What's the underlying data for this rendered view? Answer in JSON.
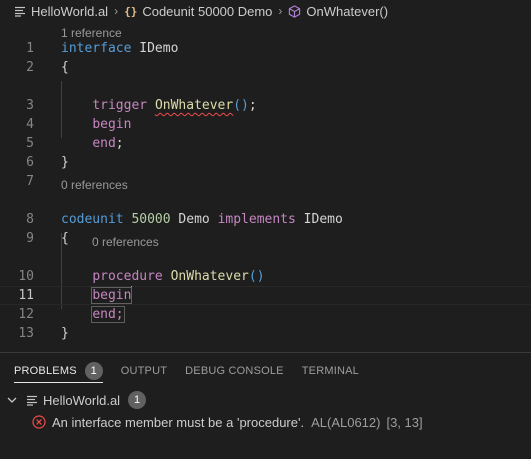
{
  "breadcrumb": {
    "file": "HelloWorld.al",
    "object": "Codeunit 50000 Demo",
    "member": "OnWhatever()"
  },
  "editor": {
    "lenses": {
      "interface_refs": "1 reference",
      "codeunit_refs": "0 references",
      "procedure_refs": "0 references"
    },
    "lines": [
      {
        "num": "1",
        "tokens": [
          {
            "t": "interface",
            "c": "kw"
          },
          {
            "t": " ",
            "c": "plain"
          },
          {
            "t": "IDemo",
            "c": "plain"
          }
        ]
      },
      {
        "num": "2",
        "tokens": [
          {
            "t": "{",
            "c": "plain"
          }
        ]
      },
      {
        "num": "3",
        "tokens": [
          {
            "t": "    ",
            "c": "plain"
          },
          {
            "t": "trigger",
            "c": "ctrl"
          },
          {
            "t": " ",
            "c": "plain"
          },
          {
            "t": "OnWhatever",
            "c": "fn squig"
          },
          {
            "t": "()",
            "c": "kw"
          },
          {
            "t": ";",
            "c": "plain"
          }
        ]
      },
      {
        "num": "4",
        "tokens": [
          {
            "t": "    ",
            "c": "plain"
          },
          {
            "t": "begin",
            "c": "ctrl"
          }
        ]
      },
      {
        "num": "5",
        "tokens": [
          {
            "t": "    ",
            "c": "plain"
          },
          {
            "t": "end",
            "c": "ctrl"
          },
          {
            "t": ";",
            "c": "plain"
          }
        ]
      },
      {
        "num": "6",
        "tokens": [
          {
            "t": "}",
            "c": "plain"
          }
        ]
      },
      {
        "num": "7",
        "tokens": []
      },
      {
        "num": "8",
        "tokens": [
          {
            "t": "codeunit",
            "c": "kw"
          },
          {
            "t": " ",
            "c": "plain"
          },
          {
            "t": "50000",
            "c": "numlit"
          },
          {
            "t": " ",
            "c": "plain"
          },
          {
            "t": "Demo",
            "c": "plain"
          },
          {
            "t": " ",
            "c": "plain"
          },
          {
            "t": "implements",
            "c": "ctrl"
          },
          {
            "t": " ",
            "c": "plain"
          },
          {
            "t": "IDemo",
            "c": "plain"
          }
        ]
      },
      {
        "num": "9",
        "tokens": [
          {
            "t": "{",
            "c": "plain"
          }
        ]
      },
      {
        "num": "10",
        "tokens": [
          {
            "t": "    ",
            "c": "plain"
          },
          {
            "t": "procedure",
            "c": "ctrl"
          },
          {
            "t": " ",
            "c": "plain"
          },
          {
            "t": "OnWhatever",
            "c": "fn"
          },
          {
            "t": "()",
            "c": "kw"
          }
        ]
      },
      {
        "num": "11",
        "tokens": [
          {
            "t": "    ",
            "c": "plain"
          },
          {
            "t": "begin",
            "c": "ctrl bracket-hl"
          }
        ],
        "cursor": true,
        "current": true
      },
      {
        "num": "12",
        "tokens": [
          {
            "t": "    ",
            "c": "plain"
          },
          {
            "t": "end;",
            "c": "ctrl sel-box"
          }
        ]
      },
      {
        "num": "13",
        "tokens": [
          {
            "t": "}",
            "c": "plain"
          }
        ]
      }
    ]
  },
  "panel": {
    "tabs": [
      {
        "label": "PROBLEMS",
        "badge": "1",
        "active": true
      },
      {
        "label": "OUTPUT"
      },
      {
        "label": "DEBUG CONSOLE"
      },
      {
        "label": "TERMINAL"
      }
    ],
    "file_group": {
      "file": "HelloWorld.al",
      "count": "1"
    },
    "problem": {
      "message": "An interface member must be a 'procedure'.",
      "code": "AL(AL0612)",
      "location": "[3, 13]"
    }
  },
  "colors": {
    "error": "#f14c4c",
    "background": "#1e1e1e",
    "keyword": "#569cd6",
    "control": "#c586c0",
    "function": "#dcdcaa",
    "number": "#b5cea8"
  },
  "icons": {
    "file": "lines-file-icon",
    "object": "braces-object-icon",
    "method": "cube-method-icon",
    "collapse": "chevron-down-icon",
    "error": "error-circle-icon"
  }
}
